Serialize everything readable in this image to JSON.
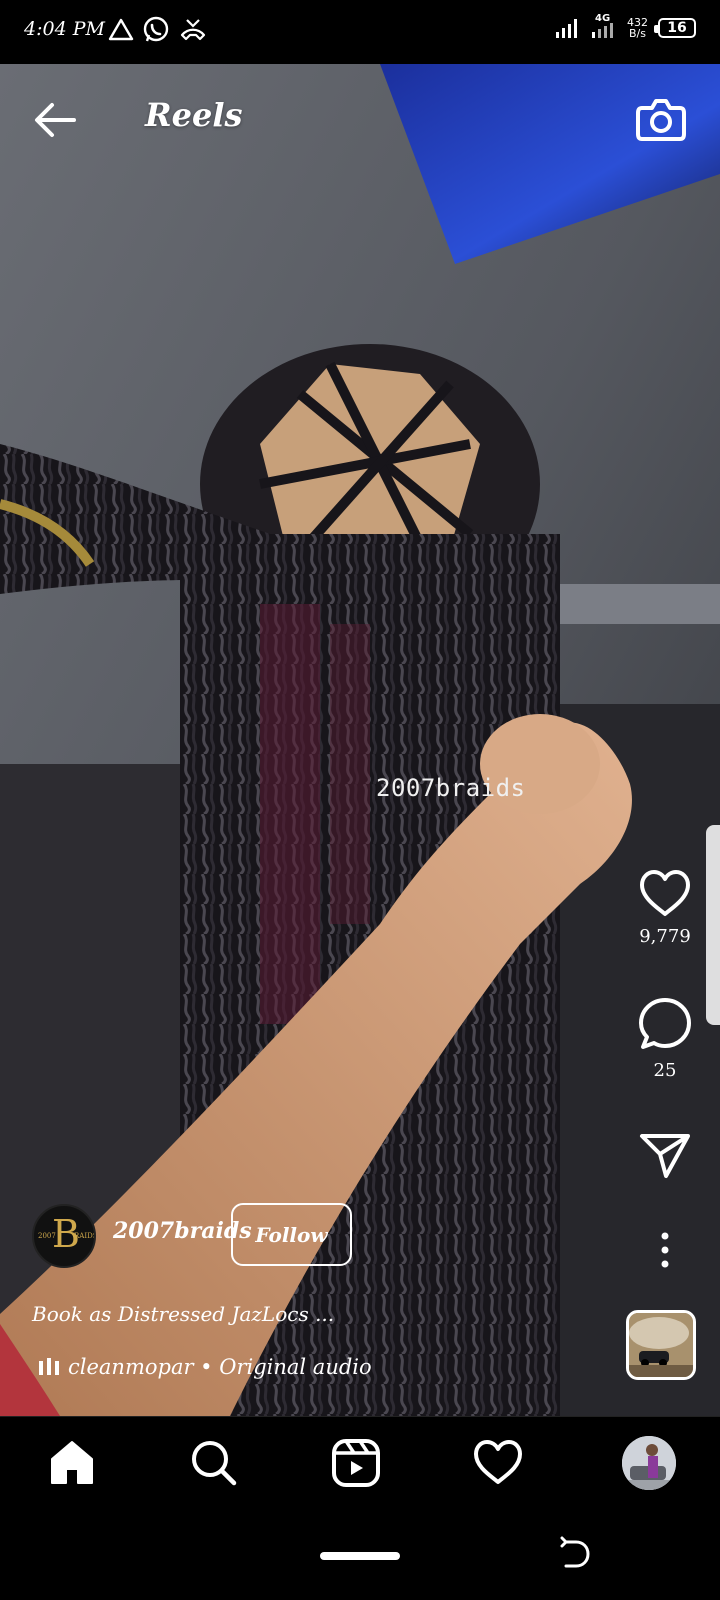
{
  "status_bar": {
    "time": "4:04 PM",
    "network": "4G",
    "speed_value": "432",
    "speed_unit": "B/s",
    "battery": "16",
    "icons": [
      "drive-icon",
      "whatsapp-icon",
      "missed-call-icon",
      "signal-icon",
      "signal-icon-2"
    ]
  },
  "header": {
    "title": "Reels",
    "icons": [
      "back-arrow-icon",
      "camera-icon"
    ]
  },
  "reel": {
    "watermark": "2007braids",
    "likes": "9,779",
    "comments": "25",
    "action_icons": [
      "heart-icon",
      "comment-icon",
      "share-icon",
      "more-icon"
    ]
  },
  "author": {
    "username": "2007braids",
    "follow_label": "Follow",
    "avatar_letter": "B",
    "avatar_left": "2007",
    "avatar_right": "RAIDS"
  },
  "caption": "Book as Distressed JazLocs ...",
  "audio": {
    "label": "cleanmopar • Original audio",
    "icon": "audio-bars-icon"
  },
  "bottom_nav": {
    "items": [
      "home-icon",
      "search-icon",
      "reels-icon",
      "activity-heart-icon",
      "profile-avatar"
    ]
  },
  "colors": {
    "background": "#000000",
    "text": "#ffffff",
    "avatar_gold": "#cfa84c"
  }
}
